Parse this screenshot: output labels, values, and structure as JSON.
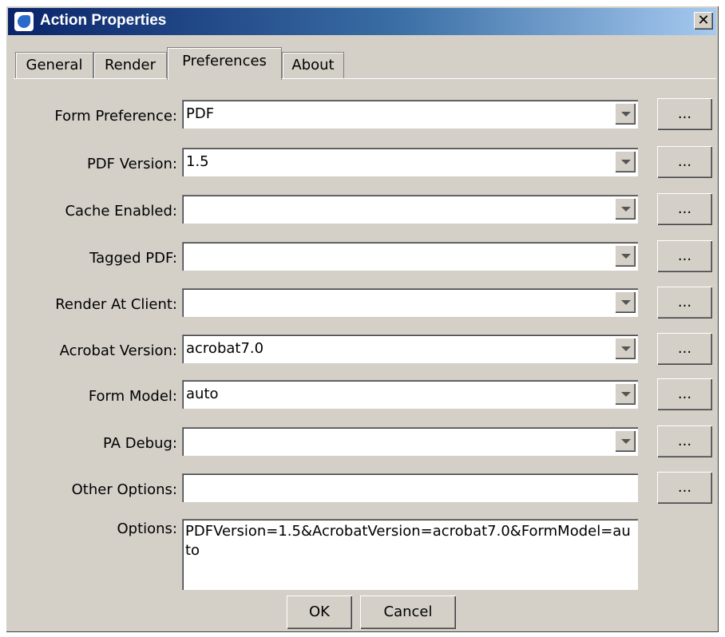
{
  "window": {
    "title": "Action Properties",
    "close_symbol": "✕"
  },
  "tabs": [
    {
      "label": "General",
      "active": false
    },
    {
      "label": "Render",
      "active": false
    },
    {
      "label": "Preferences",
      "active": true
    },
    {
      "label": "About",
      "active": false
    }
  ],
  "rows": [
    {
      "label": "Form Preference:",
      "value": "PDF"
    },
    {
      "label": "PDF Version:",
      "value": "1.5"
    },
    {
      "label": "Cache Enabled:",
      "value": ""
    },
    {
      "label": "Tagged PDF:",
      "value": ""
    },
    {
      "label": "Render At Client:",
      "value": ""
    },
    {
      "label": "Acrobat Version:",
      "value": "acrobat7.0"
    },
    {
      "label": "Form Model:",
      "value": "auto"
    },
    {
      "label": "PA Debug:",
      "value": ""
    }
  ],
  "other_options": {
    "label": "Other Options:",
    "value": ""
  },
  "ellipsis_label": "...",
  "options": {
    "label": "Options:",
    "value": "PDFVersion=1.5&AcrobatVersion=acrobat7.0&FormModel=auto"
  },
  "buttons": {
    "ok": "OK",
    "cancel": "Cancel"
  }
}
